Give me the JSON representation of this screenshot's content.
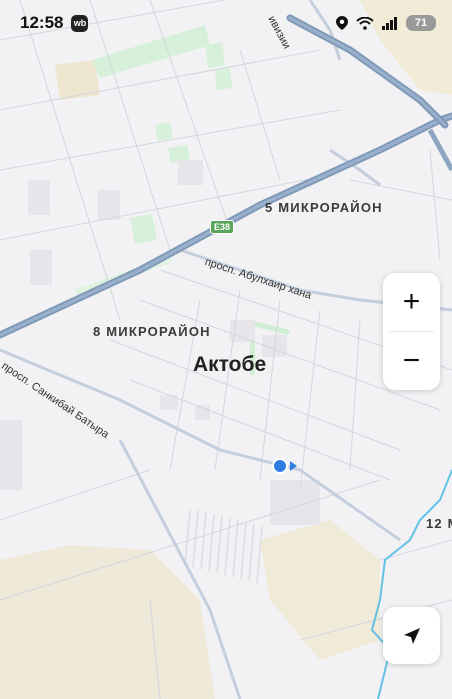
{
  "status_bar": {
    "time": "12:58",
    "app_badge": "wb",
    "battery": "71"
  },
  "map": {
    "city_label": "Актобе",
    "districts": {
      "d5": "5 МИКРОРАЙОН",
      "d8": "8 МИКРОРАЙОН",
      "d12": "12 М"
    },
    "streets": {
      "abulkhair": "просп. Абулхаир хана",
      "sankibai": "просп. Санкибай Батыра",
      "top_partial": "ивизии"
    },
    "road_shield": "E38"
  },
  "controls": {
    "zoom_in": "+",
    "zoom_out": "−"
  }
}
